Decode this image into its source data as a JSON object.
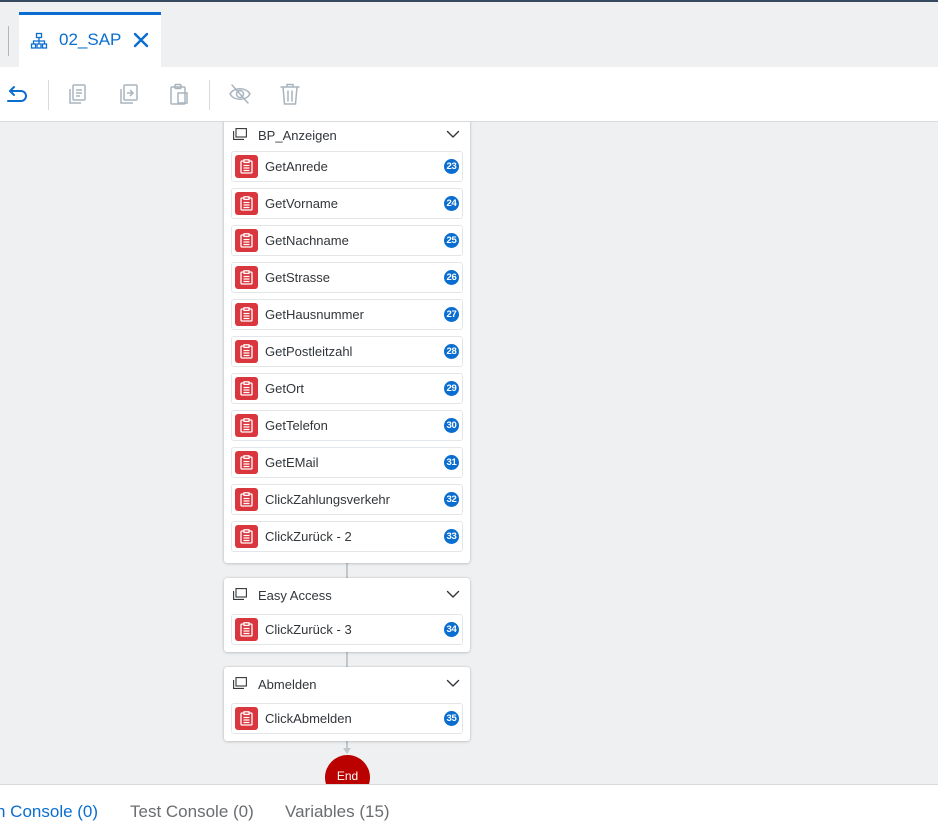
{
  "tab": {
    "title": "02_SAP"
  },
  "groups": [
    {
      "title": "BP_Anzeigen",
      "activities": [
        {
          "label": "GetAnrede",
          "badge": "23"
        },
        {
          "label": "GetVorname",
          "badge": "24"
        },
        {
          "label": "GetNachname",
          "badge": "25"
        },
        {
          "label": "GetStrasse",
          "badge": "26"
        },
        {
          "label": "GetHausnummer",
          "badge": "27"
        },
        {
          "label": "GetPostleitzahl",
          "badge": "28"
        },
        {
          "label": "GetOrt",
          "badge": "29"
        },
        {
          "label": "GetTelefon",
          "badge": "30"
        },
        {
          "label": "GetEMail",
          "badge": "31"
        },
        {
          "label": "ClickZahlungsverkehr",
          "badge": "32"
        },
        {
          "label": "ClickZurück - 2",
          "badge": "33"
        }
      ]
    },
    {
      "title": "Easy Access",
      "activities": [
        {
          "label": "ClickZurück - 3",
          "badge": "34"
        }
      ]
    },
    {
      "title": "Abmelden",
      "activities": [
        {
          "label": "ClickAbmelden",
          "badge": "35"
        }
      ]
    }
  ],
  "end_label": "End",
  "bottom_tabs": [
    {
      "label": "n Console (0)",
      "active": true
    },
    {
      "label": "Test Console (0)",
      "active": false
    },
    {
      "label": "Variables (15)",
      "active": false
    }
  ],
  "colors": {
    "accent": "#0a6ed1",
    "activity_icon": "#d9363e",
    "end_node": "#bb0000"
  }
}
